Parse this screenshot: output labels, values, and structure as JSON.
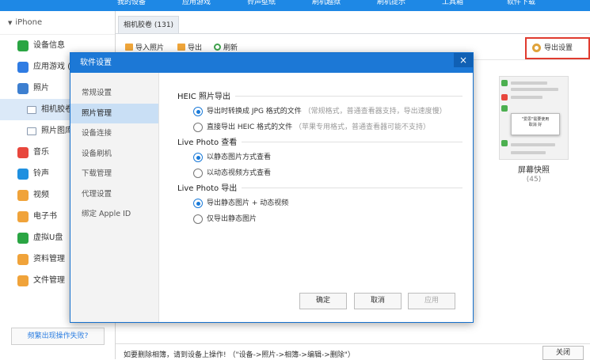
{
  "top_tabs": [
    "我的设备",
    "应用游戏",
    "铃声壁纸",
    "刷机越狱",
    "刷机提示",
    "工具箱",
    "软件下载"
  ],
  "sidebar": {
    "device": "iPhone",
    "items": [
      {
        "label": "设备信息",
        "icon": "info-icon",
        "color": "#2aa543"
      },
      {
        "label": "应用游戏 (",
        "icon": "app-store-icon",
        "color": "#2f7ce3"
      },
      {
        "label": "照片",
        "icon": "photo-icon",
        "color": "#3d7fd0"
      },
      {
        "label": "相机胶卷",
        "icon": "camera-roll-icon",
        "color": "#8a9ab0",
        "sub": true,
        "active": true
      },
      {
        "label": "照片图库",
        "icon": "photo-library-icon",
        "color": "#8a9ab0",
        "sub": true
      },
      {
        "label": "音乐",
        "icon": "music-icon",
        "color": "#e8473d"
      },
      {
        "label": "铃声",
        "icon": "bell-icon",
        "color": "#1f90e0"
      },
      {
        "label": "视频",
        "icon": "video-icon",
        "color": "#f0a33a"
      },
      {
        "label": "电子书",
        "icon": "book-icon",
        "color": "#f0a33a"
      },
      {
        "label": "虚拟U盘",
        "icon": "usb-icon",
        "color": "#2aa543"
      },
      {
        "label": "资料管理",
        "icon": "contacts-icon",
        "color": "#f0a33a"
      },
      {
        "label": "文件管理",
        "icon": "folder-icon",
        "color": "#f0a33a"
      }
    ],
    "fail_button": "频繁出现操作失败?"
  },
  "main": {
    "tab": "相机胶卷 (131)",
    "toolbar": {
      "import": "导入照片",
      "export": "导出",
      "refresh": "刷新",
      "export_settings": "导出设置"
    },
    "thumbnail": {
      "label": "屏幕快照",
      "count": "(45)"
    },
    "footer_text": "如要删除相簿，请到设备上操作! （\"设备->照片->相簿->编辑->删除\"）",
    "close": "关闭"
  },
  "dialog": {
    "title": "软件设置",
    "close_glyph": "×",
    "nav": [
      "常规设置",
      "照片管理",
      "设备连接",
      "设备刷机",
      "下载管理",
      "代理设置",
      "绑定 Apple ID"
    ],
    "active_index": 1,
    "sections": [
      {
        "title": "HEIC 照片导出",
        "options": [
          {
            "label": "导出时转换成 JPG 格式的文件",
            "hint": "（常规格式，普通查看器支持，导出速度慢）",
            "checked": true
          },
          {
            "label": "直接导出 HEIC 格式的文件",
            "hint": "（苹果专用格式，普通查看器可能不支持）",
            "checked": false
          }
        ]
      },
      {
        "title": "Live Photo 查看",
        "options": [
          {
            "label": "以静态图片方式查看",
            "hint": "",
            "checked": true
          },
          {
            "label": "以动态视频方式查看",
            "hint": "",
            "checked": false
          }
        ]
      },
      {
        "title": "Live Photo 导出",
        "options": [
          {
            "label": "导出静态图片 + 动态视频",
            "hint": "",
            "checked": true
          },
          {
            "label": "仅导出静态图片",
            "hint": "",
            "checked": false
          }
        ]
      }
    ],
    "buttons": {
      "ok": "确定",
      "cancel": "取消",
      "apply": "应用"
    }
  },
  "colors": {
    "accent": "#1c78d6",
    "highlight_border": "#e03b2f"
  }
}
